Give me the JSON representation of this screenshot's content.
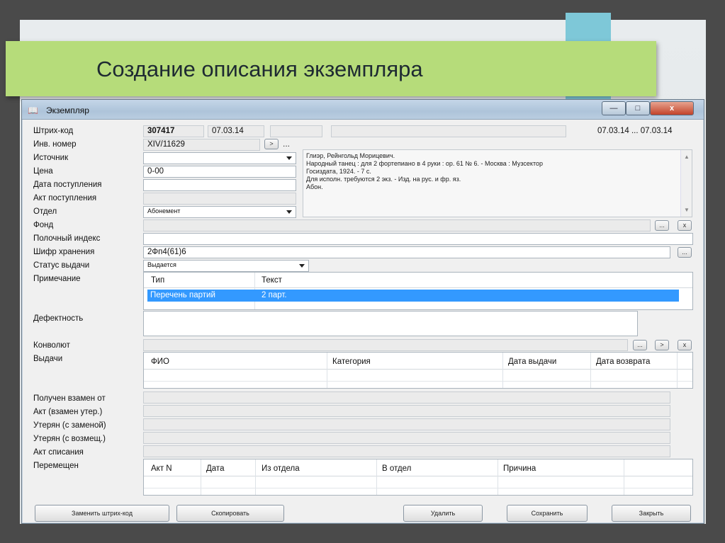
{
  "slide": {
    "title": "Создание описания экземпляра"
  },
  "window": {
    "title": "Экземпляр",
    "minimize": "—",
    "maximize": "□",
    "close": "x"
  },
  "form": {
    "barcode_label": "Штрих-код",
    "barcode_value": "307417",
    "barcode_date": "07.03.14",
    "date_range": "07.03.14 ... 07.03.14",
    "inv_label": "Инв. номер",
    "inv_value": "XIV/11629",
    "inv_btn": ">",
    "inv_more": "...",
    "source_label": "Источник",
    "source_value": "",
    "price_label": "Цена",
    "price_value": "0-00",
    "receipt_date_label": "Дата поступления",
    "receipt_date_value": "",
    "receipt_act_label": "Акт поступления",
    "receipt_act_value": "",
    "dept_label": "Отдел",
    "dept_value": "Абонемент",
    "fund_label": "Фонд",
    "fund_value": "",
    "shelf_label": "Полочный индекс",
    "shelf_value": "",
    "cipher_label": "Шифр хранения",
    "cipher_value": "2Фп4(61)6",
    "status_label": "Статус выдачи",
    "status_value": "Выдается",
    "note_label": "Примечание",
    "defect_label": "Дефектность",
    "convolute_label": "Конволют",
    "issues_label": "Выдачи",
    "received_label": "Получен взамен от",
    "act_lost_label": "Акт (взамен утер.)",
    "lost_repl_label": "Утерян (с заменой)",
    "lost_comp_label": "Утерян (с возмещ.)",
    "writeoff_label": "Акт списания",
    "moved_label": "Перемещен",
    "btn_dots": "...",
    "btn_next": ">",
    "btn_x": "x"
  },
  "description": {
    "lines": [
      "Глиэр, Рейнгольд Морицевич.",
      "    Народный танец : для 2 фортепиано в 4 руки : ор. 61 № 6. - Москва : Музсектор",
      "Госиздата, 1924. - 7 с.",
      "    Для исполн. требуются 2 экз. - Изд. на рус. и фр. яз.",
      "    Абон."
    ],
    "scroll_up": "▲",
    "scroll_down": "▼"
  },
  "notes_table": {
    "headers": [
      "Тип",
      "Текст"
    ],
    "rows": [
      {
        "type": "Перечень партий",
        "text": "2 парт."
      }
    ]
  },
  "issues_table": {
    "headers": [
      "ФИО",
      "Категория",
      "Дата выдачи",
      "Дата возврата"
    ]
  },
  "moves_table": {
    "headers": [
      "Акт N",
      "Дата",
      "Из отдела",
      "В отдел",
      "Причина"
    ]
  },
  "footer": {
    "replace_barcode": "Заменить штрих-код",
    "copy": "Скопировать",
    "delete": "Удалить",
    "save": "Сохранить",
    "close": "Закрыть"
  },
  "icons": {
    "window_icon": "book-icon"
  }
}
